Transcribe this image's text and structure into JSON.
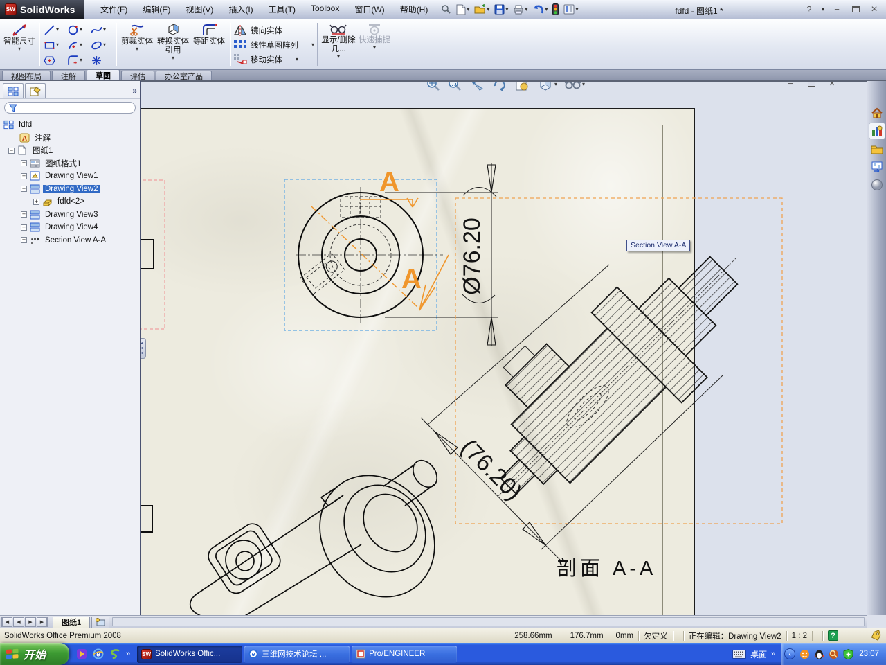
{
  "titlebar": {
    "logo_text": "SolidWorks",
    "logo_badge": "SW",
    "title": "fdfd - 图纸1 *",
    "menus": {
      "file": "文件(F)",
      "edit": "编辑(E)",
      "view": "视图(V)",
      "insert": "插入(I)",
      "tools": "工具(T)",
      "toolbox": "Toolbox",
      "window": "窗口(W)",
      "help": "帮助(H)"
    },
    "help_label": "?"
  },
  "toolbar": {
    "smart_dimension": "智能尺寸",
    "trim": "剪裁实体",
    "convert": "转换实体引用",
    "offset": "等距实体",
    "mirror": "镜向实体",
    "linear_pattern": "线性草图阵列",
    "move": "移动实体",
    "display_delete": "显示/删除几...",
    "quick_snaps": "快速捕捉"
  },
  "cm_tabs": {
    "layout": "视图布局",
    "annotation": "注解",
    "sketch": "草图",
    "evaluate": "评估",
    "office": "办公室产品"
  },
  "tree": {
    "root": "fdfd",
    "annotations": "注解",
    "sheet": "图纸1",
    "sheet_format": "图纸格式1",
    "view1": "Drawing View1",
    "view2": "Drawing View2",
    "part": "fdfd<2>",
    "view3": "Drawing View3",
    "view4": "Drawing View4",
    "section": "Section View A-A"
  },
  "drawing": {
    "tooltip": "Section View A-A",
    "section_letter": "A",
    "dia_dim": "Ø76.20",
    "section_dim": "(76.20)",
    "section_label": "剖面 A-A"
  },
  "sheet_bar": {
    "sheet1": "图纸1"
  },
  "status": {
    "product": "SolidWorks Office Premium 2008",
    "x": "258.66mm",
    "y": "176.7mm",
    "z": "0mm",
    "state": "欠定义",
    "editing": "正在编辑：Drawing View2",
    "scale": "1 : 2"
  },
  "taskbar": {
    "start": "开始",
    "task1": "SolidWorks Offic...",
    "task2": "三维网技术论坛 ...",
    "task3": "Pro/ENGINEER",
    "desktop": "桌面",
    "time": "23:07"
  },
  "glyphs": {
    "caret": "▾",
    "chevron": "»",
    "chevron2": "›",
    "prev": "◀",
    "next": "▶",
    "minimize": "−",
    "close": "×",
    "plus": "+",
    "minus": "−",
    "collapse_left": "‹",
    "tri_left": "◂"
  },
  "colors": {
    "accent_orange": "#f0962c",
    "selection_blue": "#316ac5",
    "taskbar_blue": "#2a5ade",
    "start_green": "#3d9b33",
    "paper": "#edebdf",
    "status_help_green": "#1d9e4f"
  }
}
